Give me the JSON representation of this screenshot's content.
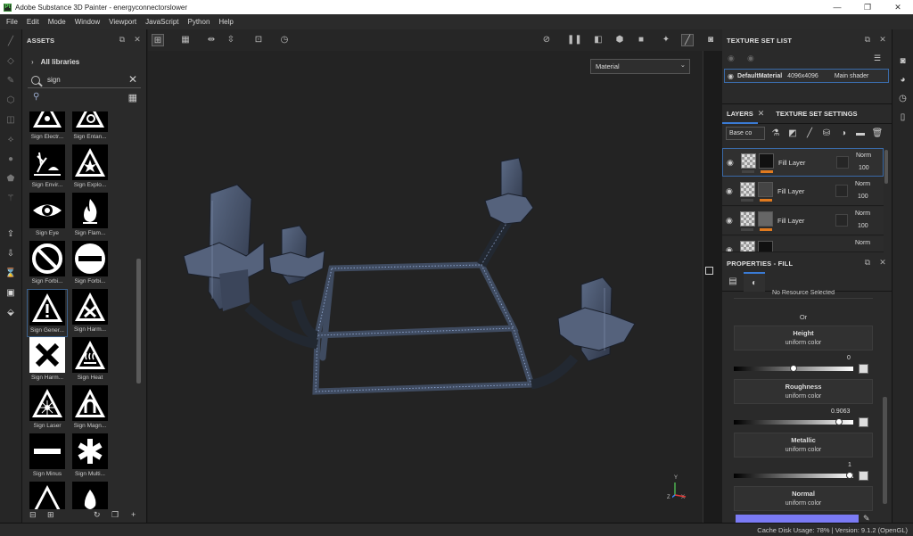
{
  "window": {
    "title": "Adobe Substance 3D Painter - energyconnectorslower",
    "app_icon": "Pt"
  },
  "menu": [
    "File",
    "Edit",
    "Mode",
    "Window",
    "Viewport",
    "JavaScript",
    "Python",
    "Help"
  ],
  "assets": {
    "title": "ASSETS",
    "library": "All libraries",
    "search_value": "sign",
    "items": [
      {
        "label": "Sign Electr...",
        "icon": "radiation-warning-icon"
      },
      {
        "label": "Sign Entan...",
        "icon": "gear-hand-warning-icon"
      },
      {
        "label": "Sign Envir...",
        "icon": "environment-hazard-icon"
      },
      {
        "label": "Sign Explo...",
        "icon": "explosive-warning-icon"
      },
      {
        "label": "Sign Eye",
        "icon": "eye-icon"
      },
      {
        "label": "Sign Flam...",
        "icon": "flame-icon"
      },
      {
        "label": "Sign Forbi...",
        "icon": "prohibited-icon"
      },
      {
        "label": "Sign Forbi...",
        "icon": "no-entry-icon"
      },
      {
        "label": "Sign Gener...",
        "icon": "exclamation-warning-icon"
      },
      {
        "label": "Sign Harm...",
        "icon": "harmful-warning-icon"
      },
      {
        "label": "Sign Harm...",
        "icon": "x-box-icon"
      },
      {
        "label": "Sign Heat",
        "icon": "heat-warning-icon"
      },
      {
        "label": "Sign Laser",
        "icon": "laser-warning-icon"
      },
      {
        "label": "Sign Magn...",
        "icon": "magnet-warning-icon"
      },
      {
        "label": "Sign Minus",
        "icon": "minus-icon"
      },
      {
        "label": "Sign Multi...",
        "icon": "asterisk-icon"
      }
    ]
  },
  "viewport": {
    "material_mode": "Material"
  },
  "texture_set_list": {
    "title": "TEXTURE SET LIST",
    "row": {
      "name": "DefaultMaterial",
      "size": "4096x4096",
      "shader": "Main shader"
    }
  },
  "layers": {
    "tab_layers": "LAYERS",
    "tab_settings": "TEXTURE SET SETTINGS",
    "channel": "Base co",
    "rows": [
      {
        "name": "Fill Layer",
        "blend": "Norm",
        "opacity": "100"
      },
      {
        "name": "Fill Layer",
        "blend": "Norm",
        "opacity": "100"
      },
      {
        "name": "Fill Layer",
        "blend": "Norm",
        "opacity": "100"
      },
      {
        "name": "",
        "blend": "Norm",
        "opacity": ""
      }
    ]
  },
  "properties": {
    "title": "PROPERTIES - FILL",
    "no_resource": "No Resource Selected",
    "or": "Or",
    "channels": [
      {
        "name": "Height",
        "mode": "uniform color",
        "value": "0",
        "level": 0.5
      },
      {
        "name": "Roughness",
        "mode": "uniform color",
        "value": "0.9063",
        "level": 0.9063
      },
      {
        "name": "Metallic",
        "mode": "uniform color",
        "value": "1",
        "level": 1
      },
      {
        "name": "Normal",
        "mode": "uniform color",
        "value": "",
        "level": null
      }
    ],
    "normal_color": "#7b7bf5"
  },
  "status": {
    "text": "Cache Disk Usage:  78% | Version: 9.1.2 (OpenGL)"
  },
  "axes": {
    "y": "Y",
    "x": "X",
    "z": "Z"
  }
}
